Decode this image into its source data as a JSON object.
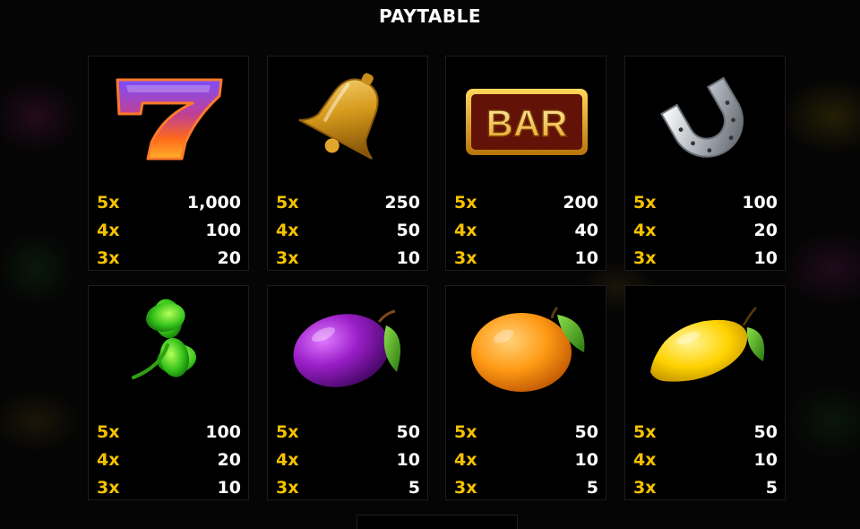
{
  "header": {
    "title": "PAYTABLE"
  },
  "symbols": [
    {
      "name": "seven",
      "icon": "seven-icon",
      "bar_label": "",
      "pays": [
        {
          "mult": "5x",
          "value": "1,000"
        },
        {
          "mult": "4x",
          "value": "100"
        },
        {
          "mult": "3x",
          "value": "20"
        }
      ]
    },
    {
      "name": "bell",
      "icon": "bell-icon",
      "bar_label": "",
      "pays": [
        {
          "mult": "5x",
          "value": "250"
        },
        {
          "mult": "4x",
          "value": "50"
        },
        {
          "mult": "3x",
          "value": "10"
        }
      ]
    },
    {
      "name": "bar",
      "icon": "bar-icon",
      "bar_label": "BAR",
      "pays": [
        {
          "mult": "5x",
          "value": "200"
        },
        {
          "mult": "4x",
          "value": "40"
        },
        {
          "mult": "3x",
          "value": "10"
        }
      ]
    },
    {
      "name": "horseshoe",
      "icon": "horseshoe-icon",
      "bar_label": "",
      "pays": [
        {
          "mult": "5x",
          "value": "100"
        },
        {
          "mult": "4x",
          "value": "20"
        },
        {
          "mult": "3x",
          "value": "10"
        }
      ]
    },
    {
      "name": "clover",
      "icon": "clover-icon",
      "bar_label": "",
      "pays": [
        {
          "mult": "5x",
          "value": "100"
        },
        {
          "mult": "4x",
          "value": "20"
        },
        {
          "mult": "3x",
          "value": "10"
        }
      ]
    },
    {
      "name": "plum",
      "icon": "plum-icon",
      "bar_label": "",
      "pays": [
        {
          "mult": "5x",
          "value": "50"
        },
        {
          "mult": "4x",
          "value": "10"
        },
        {
          "mult": "3x",
          "value": "5"
        }
      ]
    },
    {
      "name": "orange",
      "icon": "orange-icon",
      "bar_label": "",
      "pays": [
        {
          "mult": "5x",
          "value": "50"
        },
        {
          "mult": "4x",
          "value": "10"
        },
        {
          "mult": "3x",
          "value": "5"
        }
      ]
    },
    {
      "name": "lemon",
      "icon": "lemon-icon",
      "bar_label": "",
      "pays": [
        {
          "mult": "5x",
          "value": "50"
        },
        {
          "mult": "4x",
          "value": "10"
        },
        {
          "mult": "3x",
          "value": "5"
        }
      ]
    }
  ],
  "colors": {
    "multiplier": "#f6c200",
    "value": "#ffffff",
    "background": "#050505",
    "card_border": "#1c1c1c"
  }
}
